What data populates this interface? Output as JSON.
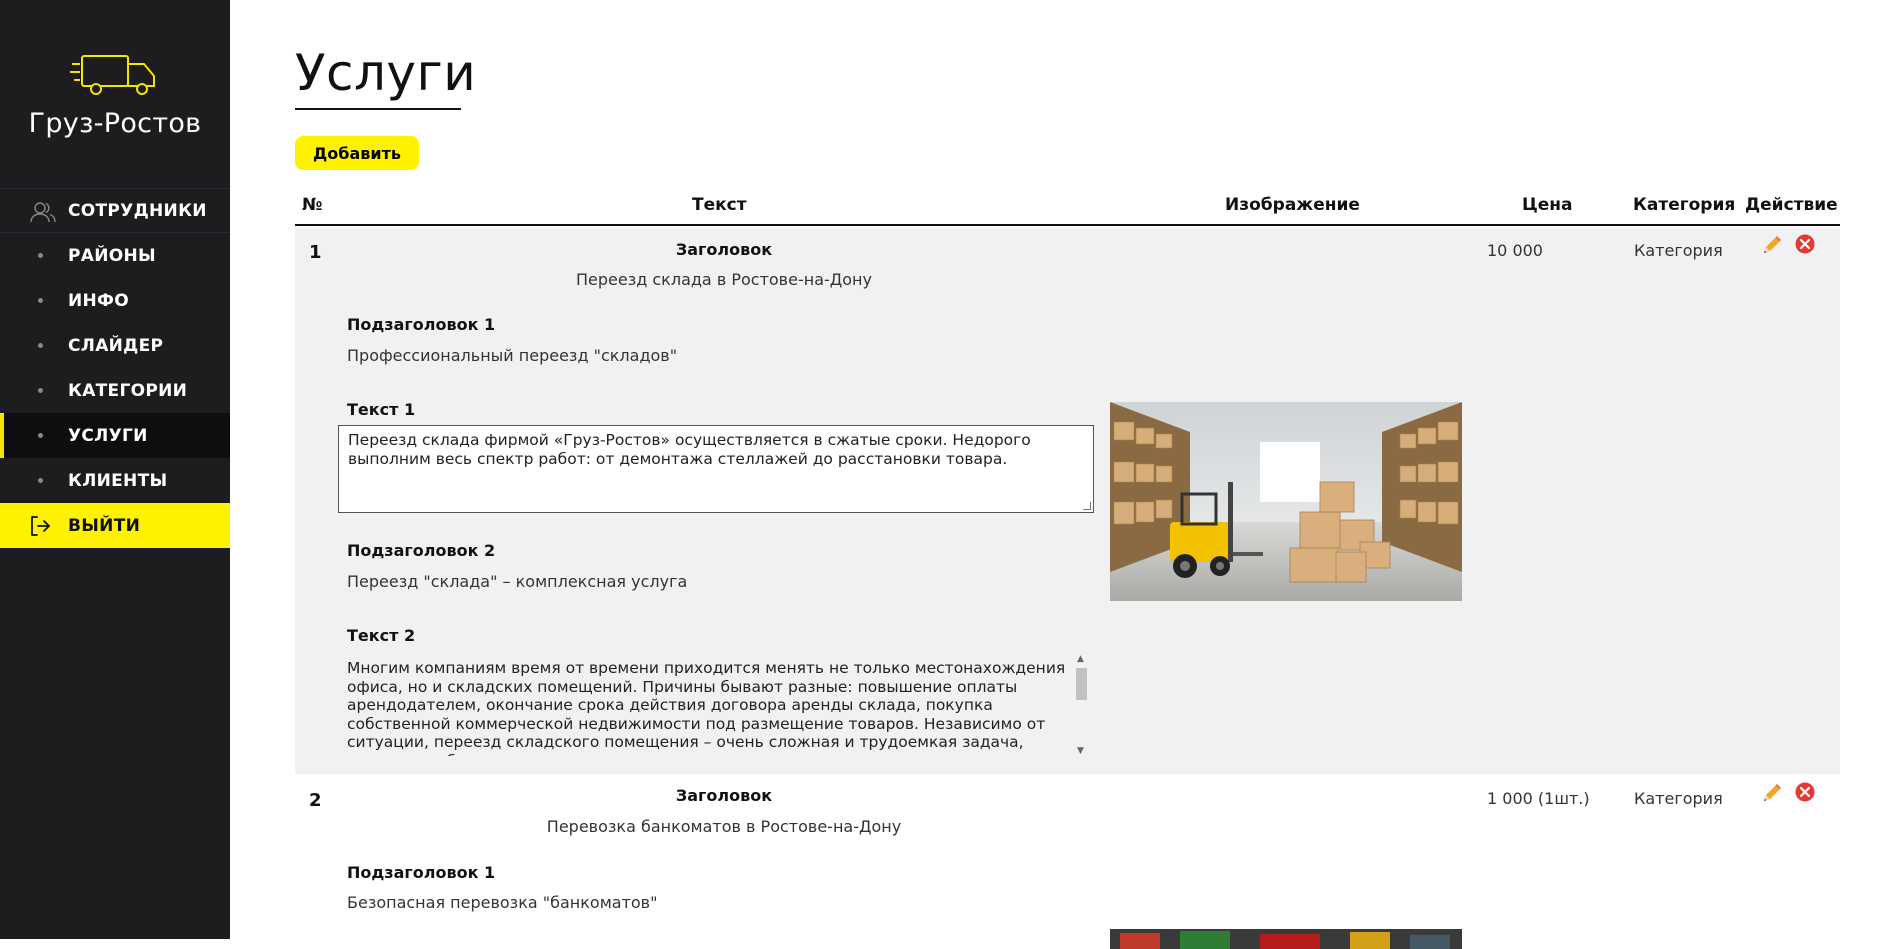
{
  "sidebar": {
    "logo_text": "Груз-Ростов",
    "items": [
      {
        "label": "СОТРУДНИКИ",
        "icon": "users-icon"
      },
      {
        "label": "РАЙОНЫ"
      },
      {
        "label": "ИНФО"
      },
      {
        "label": "СЛАЙДЕР"
      },
      {
        "label": "КАТЕГОРИИ"
      },
      {
        "label": "УСЛУГИ",
        "active": true
      },
      {
        "label": "КЛИЕНТЫ"
      }
    ],
    "logout_label": "ВЫЙТИ"
  },
  "main": {
    "title": "Услуги",
    "add_label": "Добавить",
    "columns": [
      "№",
      "Текст",
      "Изображение",
      "Цена",
      "Категория",
      "Действие"
    ],
    "rows": [
      {
        "num": "1",
        "heading_label": "Заголовок",
        "heading": "Переезд склада в Ростове-на-Дону",
        "sub1_label": "Подзаголовок 1",
        "sub1": "Профессиональный переезд \"складов\"",
        "text1_label": "Текст 1",
        "text1": "Переезд склада фирмой «Груз-Ростов» осуществляется в сжатые сроки. Недорого выполним весь спектр работ: от демонтажа стеллажей до расстановки товара.",
        "sub2_label": "Подзаголовок 2",
        "sub2": "Переезд \"склада\" – комплексная услуга",
        "text2_label": "Текст 2",
        "text2": "Многим компаниям время от времени приходится менять не только местонахождения офиса, но и складских помещений. Причины бывают разные: повышение оплаты арендодателем, окончание срока действия договора аренды склада, покупка собственной коммерческой недвижимости под размещение товаров. Независимо от ситуации, переезд складского помещения – очень сложная и трудоемкая задача, которая требует тщательного планирования, проведения",
        "price": "10 000",
        "category": "Категория"
      },
      {
        "num": "2",
        "heading_label": "Заголовок",
        "heading": "Перевозка банкоматов в Ростове-на-Дону",
        "sub1_label": "Подзаголовок 1",
        "sub1": "Безопасная перевозка \"банкоматов\"",
        "price": "1 000 (1шт.)",
        "category": "Категория"
      }
    ]
  },
  "colors": {
    "accent": "#fff200",
    "sidebar_bg": "#1d1d20",
    "row_bg": "#f1f1f1",
    "delete_red": "#e53935",
    "edit_orange": "#f4a623"
  }
}
